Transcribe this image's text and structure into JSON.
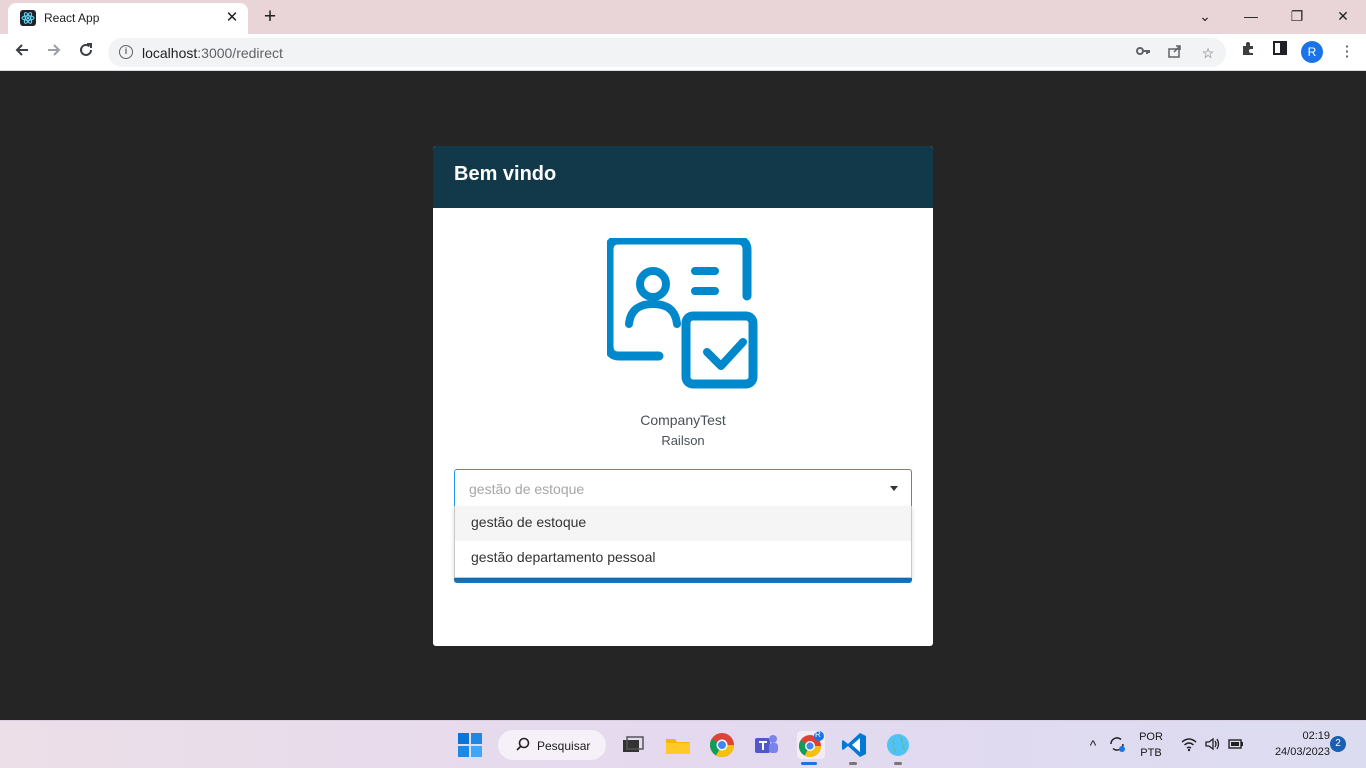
{
  "browser": {
    "tab_title": "React App",
    "tab_close": "✕",
    "new_tab": "+",
    "url_host": "localhost",
    "url_path": ":3000/redirect",
    "profile_initial": "R",
    "window_controls": {
      "minimize": "—",
      "restore": "❐",
      "close": "✕",
      "tab_search": "⌄"
    }
  },
  "card": {
    "title": "Bem vindo",
    "company": "CompanyTest",
    "user": "Railson",
    "accent_color": "#0088cc",
    "header_color": "#12394a"
  },
  "select": {
    "value": "gestão de estoque",
    "options": [
      "gestão de estoque",
      "gestão departamento pessoal"
    ]
  },
  "taskbar": {
    "search_label": "Pesquisar",
    "language_top": "POR",
    "language_bottom": "PTB",
    "time": "02:19",
    "date": "24/03/2023",
    "notifications": "2",
    "chrome_badge": "R"
  }
}
